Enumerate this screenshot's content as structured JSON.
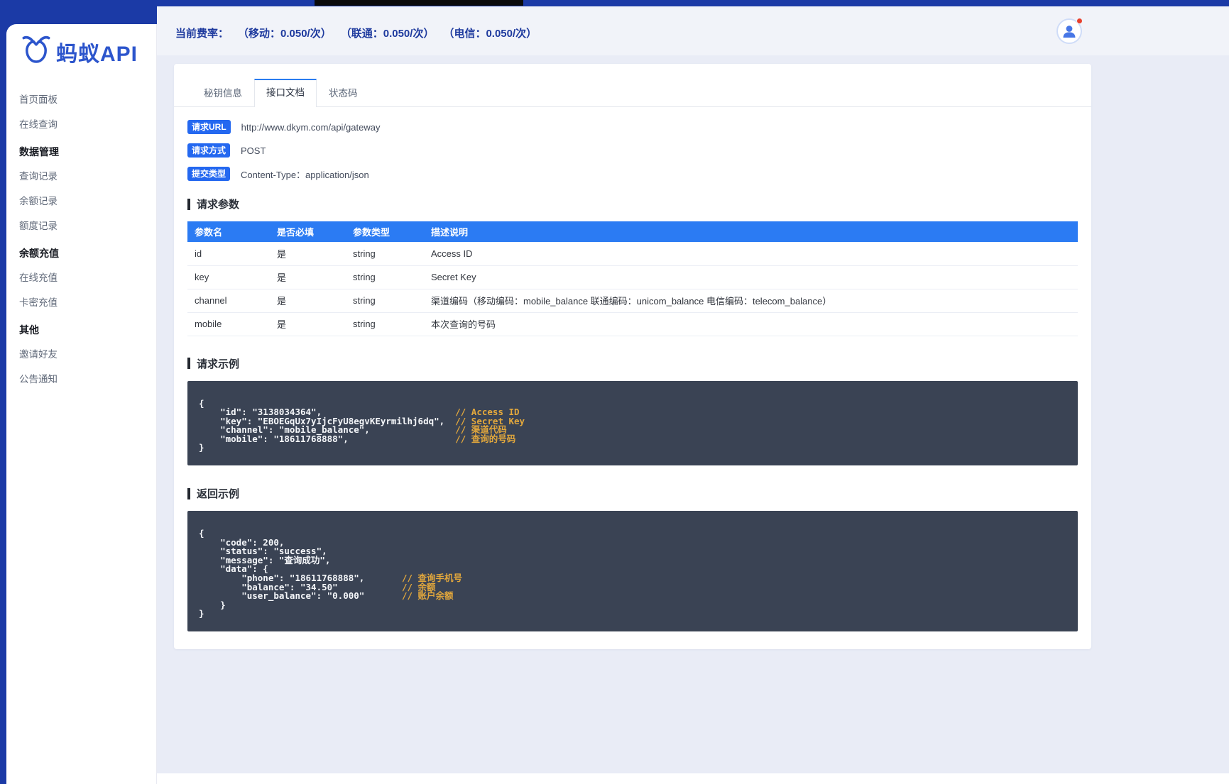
{
  "topbar": {
    "rate_label": "当前费率：",
    "rates": [
      "（移动：0.050/次）",
      "（联通：0.050/次）",
      "（电信：0.050/次）"
    ],
    "avatar_icon": "user-avatar-icon",
    "notification_dot_color": "#e8402d"
  },
  "logo": {
    "text": "蚂蚁API",
    "icon": "ant-logo-icon",
    "color": "#2c55cc"
  },
  "sidebar": {
    "groups": [
      {
        "header": "",
        "items": [
          "首页面板",
          "在线查询"
        ]
      },
      {
        "header": "数据管理",
        "items": [
          "查询记录",
          "余额记录",
          "额度记录"
        ]
      },
      {
        "header": "余额充值",
        "items": [
          "在线充值",
          "卡密充值"
        ]
      },
      {
        "header": "其他",
        "items": [
          "邀请好友",
          "公告通知"
        ]
      }
    ]
  },
  "tabs": [
    {
      "label": "秘钥信息",
      "active": false
    },
    {
      "label": "接口文档",
      "active": true
    },
    {
      "label": "状态码",
      "active": false
    }
  ],
  "request_info": [
    {
      "badge": "请求URL",
      "value": "http://www.dkym.com/api/gateway"
    },
    {
      "badge": "请求方式",
      "value": "POST"
    },
    {
      "badge": "提交类型",
      "value": "Content-Type：application/json"
    }
  ],
  "params_section": {
    "title": "请求参数",
    "header_bg": "#2b7bf3",
    "headers": [
      "参数名",
      "是否必填",
      "参数类型",
      "描述说明"
    ],
    "rows": [
      [
        "id",
        "是",
        "string",
        "Access ID"
      ],
      [
        "key",
        "是",
        "string",
        "Secret Key"
      ],
      [
        "channel",
        "是",
        "string",
        "渠道编码（移动编码：mobile_balance 联通编码：unicom_balance 电信编码：telecom_balance）"
      ],
      [
        "mobile",
        "是",
        "string",
        "本次查询的号码"
      ]
    ]
  },
  "request_example": {
    "title": "请求示例",
    "lines": [
      {
        "t": "{",
        "m": ""
      },
      {
        "t": "    \"id\": \"3138034364\",                         ",
        "m": "// Access ID"
      },
      {
        "t": "    \"key\": \"EBOEGqUx7yIjcFyU8egvKEyrmilhj6dq\",  ",
        "m": "// Secret Key"
      },
      {
        "t": "    \"channel\": \"mobile_balance\",                ",
        "m": "// 渠道代码"
      },
      {
        "t": "    \"mobile\": \"18611768888\",                    ",
        "m": "// 查询的号码"
      },
      {
        "t": "}",
        "m": ""
      }
    ]
  },
  "response_example": {
    "title": "返回示例",
    "lines": [
      {
        "t": "{",
        "m": ""
      },
      {
        "t": "    \"code\": 200,",
        "m": ""
      },
      {
        "t": "    \"status\": \"success\",",
        "m": ""
      },
      {
        "t": "    \"message\": \"查询成功\",",
        "m": ""
      },
      {
        "t": "    \"data\": {",
        "m": ""
      },
      {
        "t": "        \"phone\": \"18611768888\",       ",
        "m": "// 查询手机号"
      },
      {
        "t": "        \"balance\": \"34.50\"            ",
        "m": "// 余额"
      },
      {
        "t": "        \"user_balance\": \"0.000\"       ",
        "m": "// 账户余额"
      },
      {
        "t": "    }",
        "m": ""
      },
      {
        "t": "}",
        "m": ""
      }
    ]
  },
  "colors": {
    "frame_blue": "#1b3aa6",
    "badge_blue": "#2468f0",
    "table_header_blue": "#2b7bf3",
    "code_bg": "#3a4354",
    "code_comment": "#e3a83c",
    "body_bg": "#e9ecf6"
  }
}
